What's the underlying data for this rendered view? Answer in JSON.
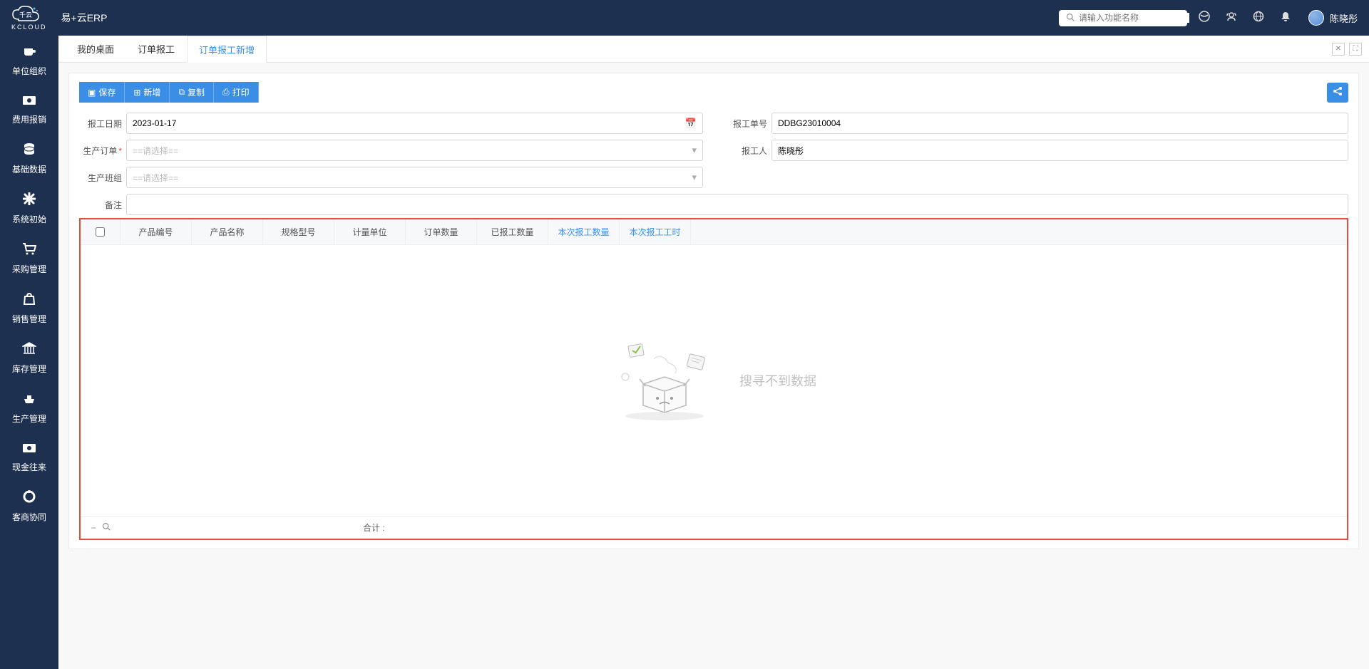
{
  "header": {
    "logo_sub": "KCLOUD",
    "app_title": "易+云ERP",
    "search_placeholder": "请输入功能名称",
    "username": "陈晓彤"
  },
  "sidebar": {
    "items": [
      {
        "label": "单位组织",
        "icon": "coffee"
      },
      {
        "label": "费用报销",
        "icon": "money"
      },
      {
        "label": "基础数据",
        "icon": "db"
      },
      {
        "label": "系统初始",
        "icon": "gear"
      },
      {
        "label": "采购管理",
        "icon": "cart"
      },
      {
        "label": "销售管理",
        "icon": "bag"
      },
      {
        "label": "库存管理",
        "icon": "bank"
      },
      {
        "label": "生产管理",
        "icon": "ship"
      },
      {
        "label": "现金往来",
        "icon": "money"
      },
      {
        "label": "客商协同",
        "icon": "ring"
      }
    ]
  },
  "tabs": [
    {
      "label": "我的桌面"
    },
    {
      "label": "订单报工"
    },
    {
      "label": "订单报工新增",
      "active": true
    }
  ],
  "toolbar": {
    "save": "保存",
    "new": "新增",
    "copy": "复制",
    "print": "打印"
  },
  "form": {
    "date_label": "报工日期",
    "date_value": "2023-01-17",
    "docno_label": "报工单号",
    "docno_value": "DDBG23010004",
    "order_label": "生产订单",
    "order_placeholder": "==请选择==",
    "reporter_label": "报工人",
    "reporter_value": "陈晓彤",
    "team_label": "生产班组",
    "team_placeholder": "==请选择==",
    "remark_label": "备注"
  },
  "table": {
    "headers": [
      "产品编号",
      "产品名称",
      "规格型号",
      "计量单位",
      "订单数量",
      "已报工数量",
      "本次报工数量",
      "本次报工工时"
    ],
    "empty_text": "搜寻不到数据",
    "sum_label": "合计 :"
  }
}
